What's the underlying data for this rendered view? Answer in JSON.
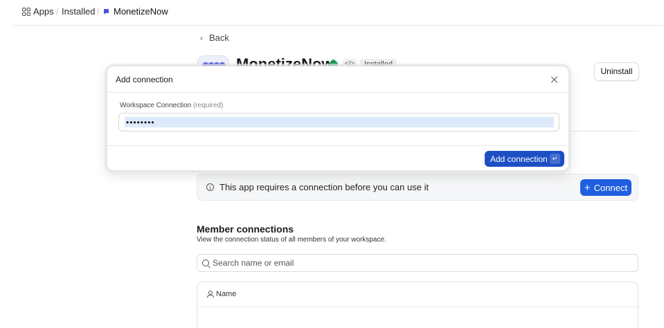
{
  "breadcrumb": {
    "apps": "Apps",
    "installed": "Installed",
    "app": "MonetizeNow",
    "separator": "/"
  },
  "page": {
    "back_label": "Back",
    "app_title": "MonetizeNow",
    "code_chip": "</>",
    "status_chip": "Installed",
    "uninstall_label": "Uninstall"
  },
  "alert": {
    "text": "This app requires a connection before you can use it",
    "button_label": "Connect",
    "button_icon": "plus-icon"
  },
  "members": {
    "title": "Member connections",
    "subtitle": "View the connection status of all members of your workspace.",
    "search_placeholder": "Search name or email",
    "columns": [
      "Name"
    ]
  },
  "modal": {
    "title": "Add connection",
    "field_label": "Workspace Connection",
    "field_required": "(required)",
    "field_value": "••••••••",
    "submit_label": "Add connection",
    "submit_shortcut": "↵"
  },
  "colors": {
    "primary": "#1d4fc4",
    "connect": "#1f5fe0",
    "verified": "#1f9d55",
    "logo": "#4b55d9"
  }
}
